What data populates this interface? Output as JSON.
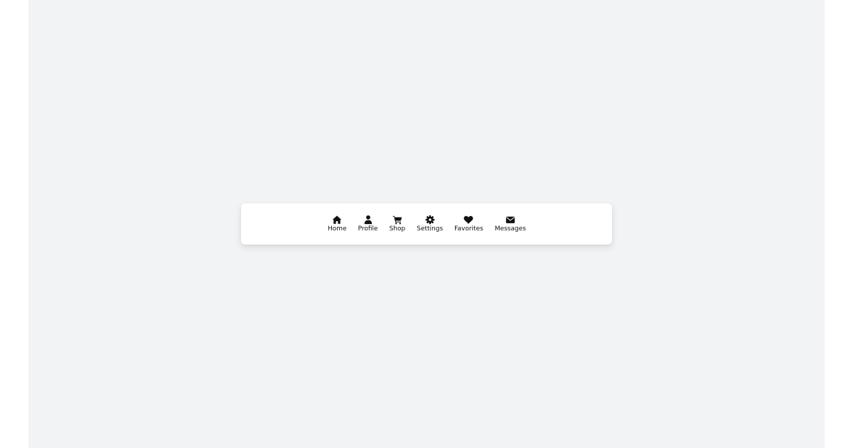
{
  "nav": {
    "items": [
      {
        "label": "Home",
        "icon": "home-icon"
      },
      {
        "label": "Profile",
        "icon": "user-icon"
      },
      {
        "label": "Shop",
        "icon": "cart-icon"
      },
      {
        "label": "Settings",
        "icon": "gear-icon"
      },
      {
        "label": "Favorites",
        "icon": "heart-icon"
      },
      {
        "label": "Messages",
        "icon": "envelope-icon"
      }
    ]
  },
  "colors": {
    "page_background": "#f2f3f5",
    "navbar_background": "#ffffff",
    "icon_color": "#111111"
  }
}
